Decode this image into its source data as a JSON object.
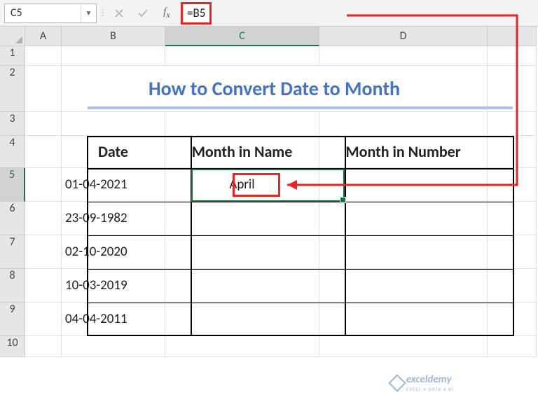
{
  "formula_bar": {
    "cell_ref": "C5",
    "formula": "=B5"
  },
  "columns": [
    "A",
    "B",
    "C",
    "D"
  ],
  "selected_col": "C",
  "selected_row": "5",
  "title": "How to Convert Date to Month",
  "headers": {
    "date": "Date",
    "month_name": "Month in Name",
    "month_num": "Month in Number"
  },
  "rows": [
    {
      "date": "01-04-2021",
      "month_name": "April",
      "month_num": ""
    },
    {
      "date": "23-09-1982",
      "month_name": "",
      "month_num": ""
    },
    {
      "date": "02-10-2020",
      "month_name": "",
      "month_num": ""
    },
    {
      "date": "10-03-2019",
      "month_name": "",
      "month_num": ""
    },
    {
      "date": "04-04-2011",
      "month_name": "",
      "month_num": ""
    }
  ],
  "watermark": {
    "brand": "exceldemy",
    "tag": "EXCEL • DATA • BI"
  },
  "chart_data": {
    "type": "table",
    "title": "How to Convert Date to Month",
    "columns": [
      "Date",
      "Month in Name",
      "Month in Number"
    ],
    "rows": [
      [
        "01-04-2021",
        "April",
        ""
      ],
      [
        "23-09-1982",
        "",
        ""
      ],
      [
        "02-10-2020",
        "",
        ""
      ],
      [
        "10-03-2019",
        "",
        ""
      ],
      [
        "04-04-2011",
        "",
        ""
      ]
    ],
    "formula": {
      "cell": "C5",
      "value": "=B5"
    }
  }
}
